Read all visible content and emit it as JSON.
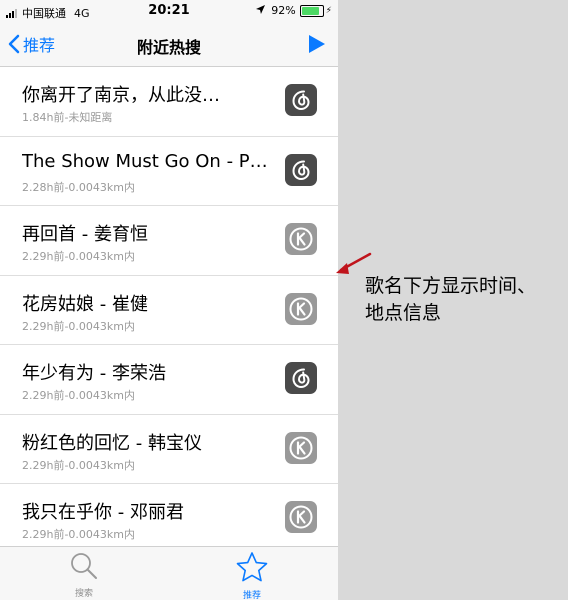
{
  "status_bar": {
    "carrier": "中国联通",
    "network": "4G",
    "time": "20:21",
    "battery": "92%",
    "battery_level": 0.92
  },
  "nav": {
    "back_label": "推荐",
    "title": "附近热搜"
  },
  "songs": [
    {
      "title": "你离开了南京，从此没…",
      "meta": "1.84h前-未知距离",
      "app": "netease"
    },
    {
      "title": "The Show Must Go On - P…",
      "meta": "2.28h前-0.0043km内",
      "app": "netease"
    },
    {
      "title": "再回首 - 姜育恒",
      "meta": "2.29h前-0.0043km内",
      "app": "kugou"
    },
    {
      "title": "花房姑娘 - 崔健",
      "meta": "2.29h前-0.0043km内",
      "app": "kugou"
    },
    {
      "title": "年少有为 - 李荣浩",
      "meta": "2.29h前-0.0043km内",
      "app": "netease"
    },
    {
      "title": "粉红色的回忆 - 韩宝仪",
      "meta": "2.29h前-0.0043km内",
      "app": "kugou"
    },
    {
      "title": "我只在乎你 - 邓丽君",
      "meta": "2.29h前-0.0043km内",
      "app": "kugou"
    }
  ],
  "tabs": {
    "search_label": "搜索",
    "recommend_label": "推荐"
  },
  "annotation": {
    "line1": "歌名下方显示时间、",
    "line2": "地点信息"
  },
  "colors": {
    "accent": "#0a7aff",
    "arrow": "#c0141c",
    "netease_icon": "#4a4a4a",
    "kugou_icon": "#999999"
  }
}
